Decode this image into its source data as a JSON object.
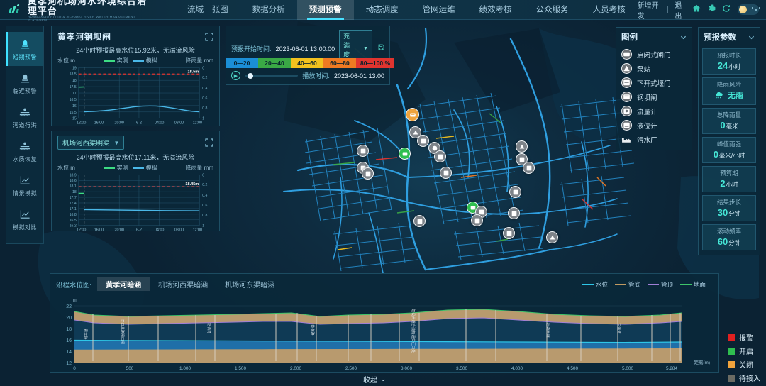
{
  "header": {
    "brand_cn": "黄孝河机场河水环境综合治理平台",
    "brand_en": "HUANGXIAO RIVER & JICHANG RIVER WATER MANAGEMENT PLATFORM",
    "nav": [
      {
        "label": "流域一张图",
        "active": false
      },
      {
        "label": "数据分析",
        "active": false
      },
      {
        "label": "预测预警",
        "active": true
      },
      {
        "label": "动态调度",
        "active": false
      },
      {
        "label": "管网运维",
        "active": false
      },
      {
        "label": "绩效考核",
        "active": false
      },
      {
        "label": "公众服务",
        "active": false
      },
      {
        "label": "人员考核",
        "active": false
      }
    ],
    "new_dev": "新增开发",
    "divider": "|",
    "logout": "退出",
    "icons": [
      "home-icon",
      "gear-icon",
      "refresh-icon"
    ]
  },
  "sidebar": {
    "items": [
      {
        "label": "短期预警",
        "icon": "alarm-light-icon",
        "active": true
      },
      {
        "label": "临近预警",
        "icon": "alarm-light-icon",
        "active": false
      },
      {
        "label": "河道行洪",
        "icon": "river-flood-icon",
        "active": false
      },
      {
        "label": "水质恢复",
        "icon": "water-quality-icon",
        "active": false
      },
      {
        "label": "情景模拟",
        "icon": "chart-line-icon",
        "active": false
      },
      {
        "label": "模拟对比",
        "icon": "chart-line-icon",
        "active": false
      }
    ]
  },
  "chart_panel_1": {
    "title": "黄孝河钢坝闸",
    "subtitle": "24小时预报最高水位15.92米，无溢流风险",
    "axis_left_label": "水位",
    "axis_left_unit": "m",
    "axis_right_label": "降雨量",
    "axis_right_unit": "mm",
    "legend": [
      {
        "label": "实测",
        "color": "#3ddc84"
      },
      {
        "label": "模拟",
        "color": "#4ab8e8"
      }
    ],
    "threshold_label": "18.5m"
  },
  "chart_panel_2": {
    "selected": "机场河西渠明渠",
    "subtitle": "24小时预报最高水位17.11米，无溢流风险",
    "axis_left_label": "水位",
    "axis_left_unit": "m",
    "axis_right_label": "降雨量",
    "axis_right_unit": "mm",
    "legend": [
      {
        "label": "实测",
        "color": "#3ddc84"
      },
      {
        "label": "模拟",
        "color": "#4ab8e8"
      }
    ],
    "threshold_label": "18.45m"
  },
  "control_bar": {
    "start_label": "预报开始时间:",
    "start_value": "2023-06-01 13:00:00",
    "metric_selected": "充满度 %",
    "save_icon": "save-icon",
    "play_icon": "play-icon",
    "playtime_label": "播放时间:",
    "playtime_value": "2023-06-01 13:00"
  },
  "color_scale": {
    "segments": [
      {
        "label": "0—20",
        "color": "#1b8ed6"
      },
      {
        "label": "20—40",
        "color": "#3aa845"
      },
      {
        "label": "40—60",
        "color": "#f2c11e"
      },
      {
        "label": "60—80",
        "color": "#ef7a22"
      },
      {
        "label": "80—100 %",
        "color": "#e0342f"
      }
    ]
  },
  "legend_panel": {
    "title": "图例",
    "items": [
      {
        "label": "启闭式闸门",
        "icon": "gate-valve-icon"
      },
      {
        "label": "泵站",
        "icon": "pump-station-icon"
      },
      {
        "label": "下开式堰门",
        "icon": "weir-gate-icon"
      },
      {
        "label": "钢坝闸",
        "icon": "steel-dam-icon"
      },
      {
        "label": "流量计",
        "icon": "flow-meter-icon"
      },
      {
        "label": "液位计",
        "icon": "level-meter-icon"
      },
      {
        "label": "污水厂",
        "icon": "sewage-plant-icon"
      }
    ]
  },
  "params_panel": {
    "title": "预报参数",
    "items": [
      {
        "label": "预报时长",
        "value": "24",
        "unit": "小时",
        "icon": ""
      },
      {
        "label": "降雨风险",
        "value": "",
        "unit": "无雨",
        "icon": "cloud-rain-icon"
      },
      {
        "label": "总降雨量",
        "value": "0",
        "unit": "毫米",
        "icon": ""
      },
      {
        "label": "峰值雨强",
        "value": "0",
        "unit": "毫米/小时",
        "icon": ""
      },
      {
        "label": "预算期",
        "value": "2",
        "unit": "小时",
        "icon": ""
      },
      {
        "label": "结果步长",
        "value": "30",
        "unit": "分钟",
        "icon": ""
      },
      {
        "label": "滚动频率",
        "value": "60",
        "unit": "分钟",
        "icon": ""
      }
    ]
  },
  "bottom_panel": {
    "label": "沿程水位图:",
    "tabs": [
      {
        "label": "黄孝河暗涵",
        "active": true
      },
      {
        "label": "机场河西渠暗涵",
        "active": false
      },
      {
        "label": "机场河东渠暗涵",
        "active": false
      }
    ],
    "legend": [
      {
        "label": "水位",
        "color": "#2ec7e8"
      },
      {
        "label": "管底",
        "color": "#c09a62"
      },
      {
        "label": "管顶",
        "color": "#a07fd6"
      },
      {
        "label": "地面",
        "color": "#3ec46a"
      }
    ],
    "collapse_label": "收起"
  },
  "status_legend": {
    "items": [
      {
        "label": "报警",
        "color": "#e02020"
      },
      {
        "label": "开启",
        "color": "#2fbe4f"
      },
      {
        "label": "关闭",
        "color": "#f0a33c"
      },
      {
        "label": "待接入",
        "color": "#6b6b63"
      }
    ]
  },
  "chart_data": [
    {
      "type": "line",
      "id": "huangxiaohe-gangbazha",
      "title": "黄孝河钢坝闸",
      "subtitle": "24小时预报最高水位15.92米，无溢流风险",
      "xlabel": "",
      "ylabel": "水位 m",
      "y2label": "降雨量 mm",
      "ylim": [
        15,
        19
      ],
      "yticks": [
        15,
        15.5,
        16,
        16.5,
        17,
        17.5,
        18,
        18.5,
        19
      ],
      "y2lim": [
        1,
        0
      ],
      "y2ticks": [
        0,
        0.2,
        0.4,
        0.6,
        0.8,
        1
      ],
      "xticks": [
        "12:00",
        "16:00",
        "20:00",
        "6-2",
        "04:00",
        "08:00",
        "12:00"
      ],
      "threshold": 18.5,
      "threshold_label": "18.5m",
      "grid": true,
      "series": [
        {
          "name": "实测",
          "color": "#3ddc84",
          "x": [
            0,
            0.4,
            0.8,
            1.2
          ],
          "values": [
            17.45,
            17.46,
            17.47,
            17.48
          ]
        },
        {
          "name": "模拟",
          "color": "#4ab8e8",
          "x": [
            1.2,
            2,
            3,
            4,
            5,
            6,
            7,
            8,
            9,
            10,
            11,
            12,
            13,
            14,
            15,
            16,
            17,
            18,
            19,
            20,
            21,
            22,
            23,
            24
          ],
          "values": [
            15.62,
            15.63,
            15.64,
            15.66,
            15.68,
            15.7,
            15.72,
            15.74,
            15.77,
            15.82,
            15.88,
            15.91,
            15.92,
            15.91,
            15.88,
            15.84,
            15.79,
            15.74,
            15.69,
            15.64,
            15.6,
            15.57,
            15.55,
            15.55
          ]
        }
      ]
    },
    {
      "type": "line",
      "id": "jichanghe-xiqu",
      "title": "机场河西渠明渠",
      "subtitle": "24小时预报最高水位17.11米，无溢流风险",
      "xlabel": "",
      "ylabel": "水位 m",
      "y2label": "降雨量 mm",
      "ylim": [
        16.2,
        18.9
      ],
      "yticks": [
        16.2,
        16.5,
        16.8,
        17.1,
        17.4,
        17.7,
        18,
        18.1,
        18.6,
        18.9
      ],
      "y2lim": [
        1,
        0
      ],
      "y2ticks": [
        0,
        0.2,
        0.4,
        0.6,
        0.8,
        1
      ],
      "xticks": [
        "12:00",
        "16:00",
        "20:00",
        "6-2",
        "04:00",
        "08:00",
        "12:00"
      ],
      "threshold": 18.45,
      "threshold_label": "18.45m",
      "grid": true,
      "series": [
        {
          "name": "实测",
          "color": "#3ddc84",
          "x": [
            0,
            0.4,
            0.8,
            1.2
          ],
          "values": [
            17.85,
            17.85,
            17.85,
            17.85
          ]
        },
        {
          "name": "模拟",
          "color": "#4ab8e8",
          "x": [
            1.2,
            4,
            8,
            12,
            16,
            20,
            24
          ],
          "values": [
            17.11,
            17.08,
            17.05,
            17.03,
            17.02,
            17.01,
            17.01
          ]
        }
      ]
    },
    {
      "type": "area",
      "id": "changitudinal-profile",
      "title": "沿程水位图 - 黄孝河暗涵",
      "xlabel": "距离(m)",
      "ylabel": "m",
      "xlim": [
        0,
        5284
      ],
      "xticks": [
        0,
        500,
        1000,
        1500,
        2000,
        2500,
        3000,
        3500,
        4000,
        4500,
        5000,
        5284
      ],
      "xticklabels": [
        "0",
        "500",
        "1,000",
        "1,500",
        "2,000",
        "2,500",
        "3,000",
        "3,500",
        "4,000",
        "4,500",
        "5,000",
        "5,284"
      ],
      "ylim": [
        12,
        22
      ],
      "yticks": [
        12,
        14,
        16,
        18,
        20,
        22
      ],
      "series": [
        {
          "name": "地面",
          "color": "#3ec46a",
          "x": [
            0,
            300,
            600,
            900,
            1200,
            1500,
            1800,
            2100,
            2400,
            2700,
            3000,
            3300,
            3600,
            3900,
            4200,
            4500,
            4800,
            5284
          ],
          "values": [
            21.0,
            20.4,
            20.3,
            20.4,
            20.5,
            20.3,
            20.2,
            20.3,
            20.6,
            20.8,
            21.0,
            20.9,
            20.7,
            20.5,
            20.3,
            20.2,
            20.4,
            20.6
          ]
        },
        {
          "name": "管顶",
          "color": "#a07fd6",
          "x": [
            0,
            300,
            600,
            900,
            1200,
            1500,
            1800,
            2100,
            2400,
            2700,
            3000,
            3300,
            3600,
            3900,
            4200,
            4500,
            4800,
            5284
          ],
          "values": [
            20.3,
            19.6,
            19.4,
            19.4,
            19.5,
            19.4,
            19.3,
            19.3,
            19.5,
            19.7,
            19.9,
            19.8,
            19.6,
            19.3,
            19.1,
            19.0,
            19.2,
            19.5
          ]
        },
        {
          "name": "水位",
          "color": "#2ec7e8",
          "x": [
            0,
            300,
            600,
            900,
            1200,
            1500,
            1800,
            2100,
            2400,
            2700,
            3000,
            3300,
            3600,
            3900,
            4200,
            4500,
            4800,
            5284
          ],
          "values": [
            16.4,
            16.4,
            16.4,
            16.4,
            16.4,
            16.3,
            16.3,
            16.3,
            16.3,
            16.2,
            16.2,
            16.2,
            16.1,
            16.1,
            16.1,
            16.0,
            16.0,
            16.2
          ]
        },
        {
          "name": "管底",
          "color": "#c09a62",
          "x": [
            0,
            300,
            600,
            900,
            1200,
            1500,
            1800,
            2100,
            2400,
            2700,
            3000,
            3300,
            3600,
            3900,
            4200,
            4500,
            4800,
            5284
          ],
          "values": [
            16.0,
            15.9,
            15.8,
            15.8,
            15.7,
            15.6,
            15.6,
            15.6,
            15.5,
            15.4,
            15.3,
            15.3,
            15.2,
            15.2,
            15.2,
            15.1,
            15.1,
            15.4
          ]
        }
      ],
      "annotations": [
        "青年路",
        "汉口北路闸口闸",
        "常青路",
        "建设大道合流箱涵交汇口处"
      ]
    }
  ]
}
